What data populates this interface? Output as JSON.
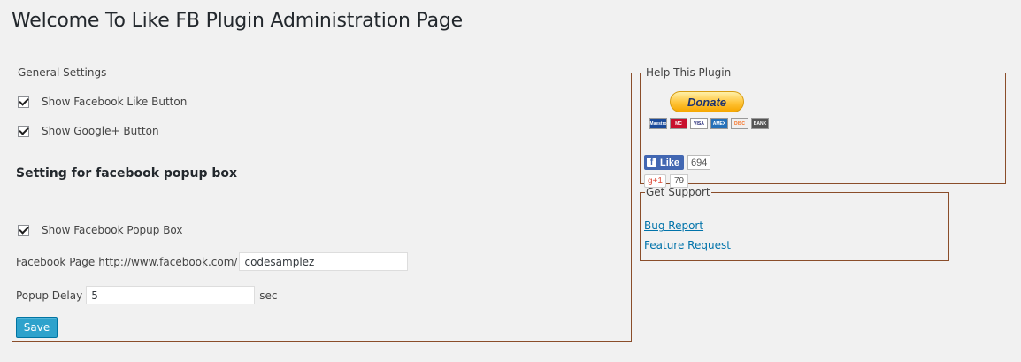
{
  "page_title": "Welcome To Like FB Plugin Administration Page",
  "general": {
    "legend": "General Settings",
    "show_like_label": "Show Facebook Like Button",
    "show_like_checked": true,
    "show_gplus_label": "Show Google+ Button",
    "show_gplus_checked": true,
    "popup_heading": "Setting for facebook popup box",
    "show_popup_label": "Show Facebook Popup Box",
    "show_popup_checked": true,
    "fb_page_label": "Facebook Page",
    "fb_page_prefix": "http://www.facebook.com/",
    "fb_page_value": "codesamplez",
    "popup_delay_label": "Popup Delay",
    "popup_delay_value": "5",
    "popup_delay_unit": "sec",
    "save_label": "Save"
  },
  "help": {
    "legend": "Help This Plugin",
    "donate_label": "Donate",
    "cards": [
      {
        "label": "Maestro",
        "color": "#1a4a9a"
      },
      {
        "label": "MC",
        "color": "#c8102e"
      },
      {
        "label": "VISA",
        "color": "#ffffff"
      },
      {
        "label": "AMEX",
        "color": "#2671b9"
      },
      {
        "label": "DISC",
        "color": "#f0f0f0"
      },
      {
        "label": "BANK",
        "color": "#555555"
      }
    ],
    "fb_like_label": "Like",
    "fb_like_count": "694",
    "gplus_label": "g+1",
    "gplus_count": "79"
  },
  "support": {
    "legend": "Get Support",
    "bug_report": "Bug Report",
    "feature_request": "Feature Request"
  },
  "colors": {
    "background": "#f1f1f1",
    "fieldset_border": "#8a4d2a",
    "button_primary": "#2ea2cc",
    "link": "#0073aa"
  }
}
